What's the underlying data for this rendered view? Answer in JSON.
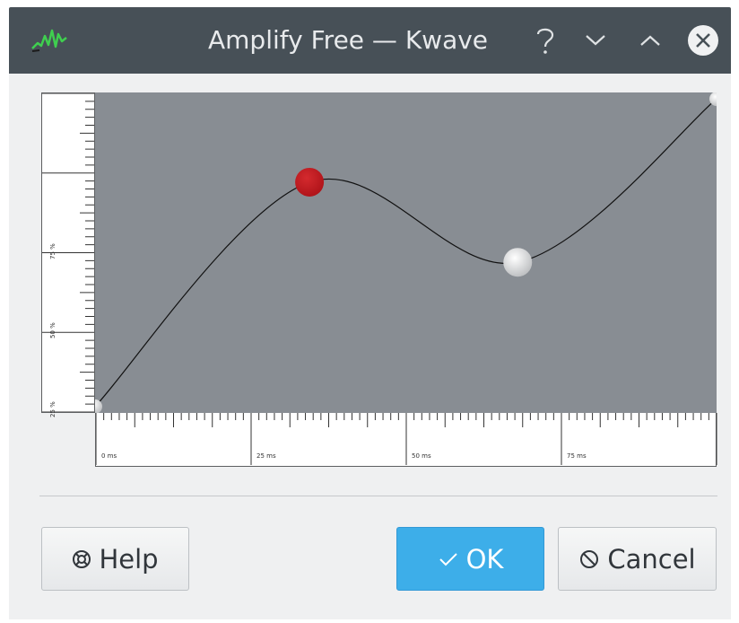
{
  "window": {
    "title": "Amplify Free — Kwave",
    "app_icon": "kwave-waveform-icon",
    "controls": [
      "help-icon",
      "minimize-icon",
      "maximize-icon",
      "close-icon"
    ]
  },
  "curve_editor": {
    "y_axis_labels": [
      "75 %",
      "50 %",
      "25 %"
    ],
    "x_axis_labels": [
      "0 ms",
      "25 ms",
      "50 ms",
      "75 ms"
    ],
    "curve_points": [
      {
        "time_fraction": 0.0,
        "amplitude_fraction": 0.02,
        "selected": false
      },
      {
        "time_fraction": 0.345,
        "amplitude_fraction": 0.72,
        "selected": true
      },
      {
        "time_fraction": 0.68,
        "amplitude_fraction": 0.47,
        "selected": false
      },
      {
        "time_fraction": 1.0,
        "amplitude_fraction": 0.98,
        "selected": false
      }
    ],
    "colors": {
      "background": "#888d93",
      "selected_point": "#b0141a",
      "point": "#f4f4f4"
    }
  },
  "buttons": {
    "help": "Help",
    "ok": "OK",
    "cancel": "Cancel"
  }
}
